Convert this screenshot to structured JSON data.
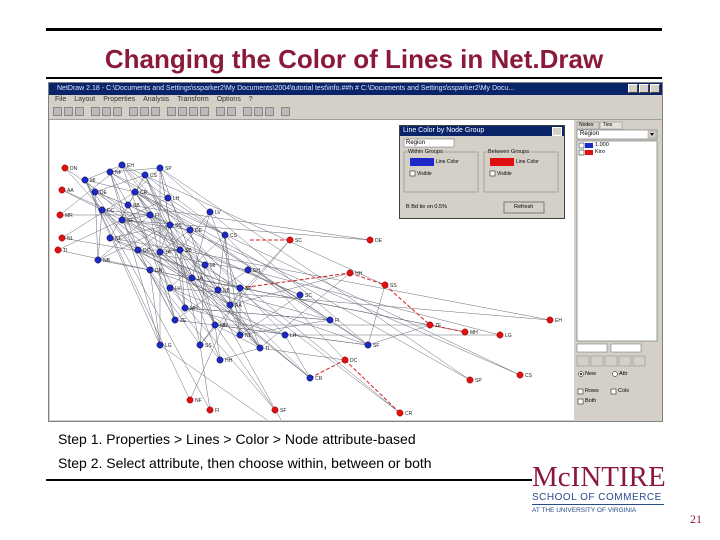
{
  "slide": {
    "title": "Changing the Color of Lines in Net.Draw",
    "step1": "Step 1. Properties > Lines > Color > Node attribute-based",
    "step2": "Step 2. Select attribute, then choose within, between or both",
    "page_number": "21"
  },
  "logo": {
    "name": "McINTIRE",
    "line1": "SCHOOL OF COMMERCE",
    "line2": "AT THE UNIVERSITY OF VIRGINIA",
    "color": "#8b1a3a"
  },
  "app": {
    "window_title": "NetDraw 2.18 - C:\\Documents and Settings\\ssparker2\\My Documents\\2004\\tutorial test\\info.##h # C:\\Documents and Settings\\ssparker2\\My Docu...",
    "menu": [
      "File",
      "Layout",
      "Properties",
      "Analysis",
      "Transform",
      "Options",
      "?"
    ],
    "right_tabs": [
      "Nodes",
      "Ties"
    ],
    "attribute_select": "Region",
    "legend": [
      {
        "label": "1.000",
        "checked": true
      },
      {
        "label": "Kiro",
        "checked": true
      }
    ],
    "dialog": {
      "title": "Line Color by Node Group",
      "select": "Region",
      "within_label": "Within Groups",
      "between_label": "Between Groups",
      "color_label": "Line Color",
      "visible_label": "Visible",
      "threshold_label": "B Bd tie on 0.5%",
      "button": "Refresh"
    },
    "bottom_panel": {
      "rel_label": "New",
      "attr_label": "Attr",
      "radio1": "Rows",
      "radio2": "Cols",
      "radio3": "Both"
    },
    "colors": {
      "blue_node": "#1c28c8",
      "red_node": "#e01010",
      "red_line": "#d42020"
    }
  },
  "network": {
    "node_labels": [
      "EH",
      "CS",
      "SP",
      "CR",
      "LH",
      "SF",
      "FI",
      "SC",
      "DE",
      "DC",
      "NF",
      "SB",
      "MI",
      "NB",
      "JA",
      "LV",
      "DN",
      "AA",
      "MR",
      "NL",
      "TI",
      "HH",
      "SS",
      "ZE",
      "MH",
      "LG"
    ]
  }
}
